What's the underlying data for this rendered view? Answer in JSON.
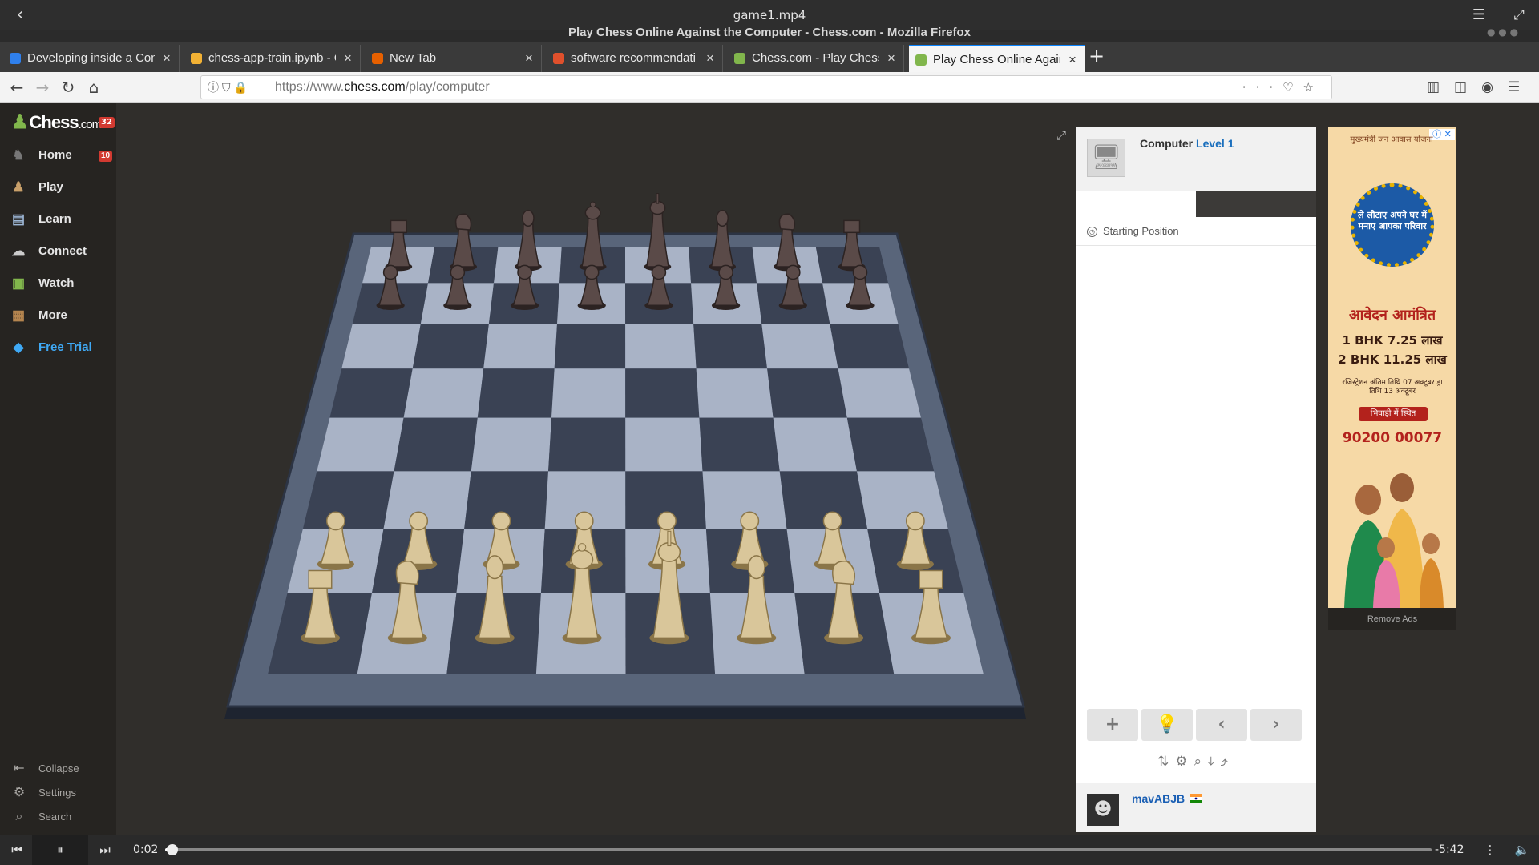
{
  "player": {
    "file_title": "game1.mp4",
    "time_current": "0:02",
    "time_remaining": "-5:42",
    "progress": 0.006
  },
  "window": {
    "title": "Play Chess Online Against the Computer - Chess.com - Mozilla Firefox"
  },
  "tabs": [
    {
      "label": "Developing inside a Cont",
      "active": false,
      "favicon_color": "#2f80ed"
    },
    {
      "label": "chess-app-train.ipynb - C",
      "active": false,
      "favicon_color": "#f2b134"
    },
    {
      "label": "New Tab",
      "active": false,
      "favicon_color": "#e66000"
    },
    {
      "label": "software recommendati",
      "active": false,
      "favicon_color": "#e0502c"
    },
    {
      "label": "Chess.com - Play Chess O",
      "active": false,
      "favicon_color": "#81b64c"
    },
    {
      "label": "Play Chess Online Agains",
      "active": true,
      "favicon_color": "#81b64c"
    }
  ],
  "url": {
    "prefix": "https://www.",
    "domain": "chess.com",
    "path": "/play/computer"
  },
  "site": {
    "logo": "Chess",
    "logo_suffix": ".com",
    "logo_badge": "32",
    "nav": [
      {
        "label": "Home",
        "icon": "home-icon",
        "badge": "10"
      },
      {
        "label": "Play",
        "icon": "play-icon"
      },
      {
        "label": "Learn",
        "icon": "learn-icon"
      },
      {
        "label": "Connect",
        "icon": "connect-icon"
      },
      {
        "label": "Watch",
        "icon": "watch-icon"
      },
      {
        "label": "More",
        "icon": "more-icon"
      },
      {
        "label": "Free Trial",
        "icon": "diamond-icon"
      }
    ],
    "footer": [
      {
        "label": "Collapse",
        "icon": "collapse-icon"
      },
      {
        "label": "Settings",
        "icon": "gear-icon"
      },
      {
        "label": "Search",
        "icon": "search-icon"
      }
    ]
  },
  "game": {
    "opponent_name": "Computer",
    "opponent_level": "Level 1",
    "status": "Starting Position",
    "player_name": "mavABJB",
    "player_flag": "flag-india-icon"
  },
  "ad": {
    "top_text": "मुख्यमंत्री जन आवास योजना",
    "badge_text": "ले लौटाए अपने घर में मनाए आपका परिवार",
    "headline": "आवेदन आमंत्रित",
    "line1": "1 BHK 7.25 लाख",
    "line2": "2 BHK 11.25 लाख",
    "small": "रजिस्ट्रेशन अंतिम तिथि 07 अक्टूबर ड्रा तिथि 13 अक्टूबर",
    "location": "भिवाड़ी में स्थित",
    "phone": "90200 00077",
    "remove": "Remove Ads"
  },
  "colors": {
    "accent": "#81b64c",
    "trial": "#3fa9f5",
    "board_light": "#a9b3c6",
    "board_dark": "#3a4254"
  }
}
